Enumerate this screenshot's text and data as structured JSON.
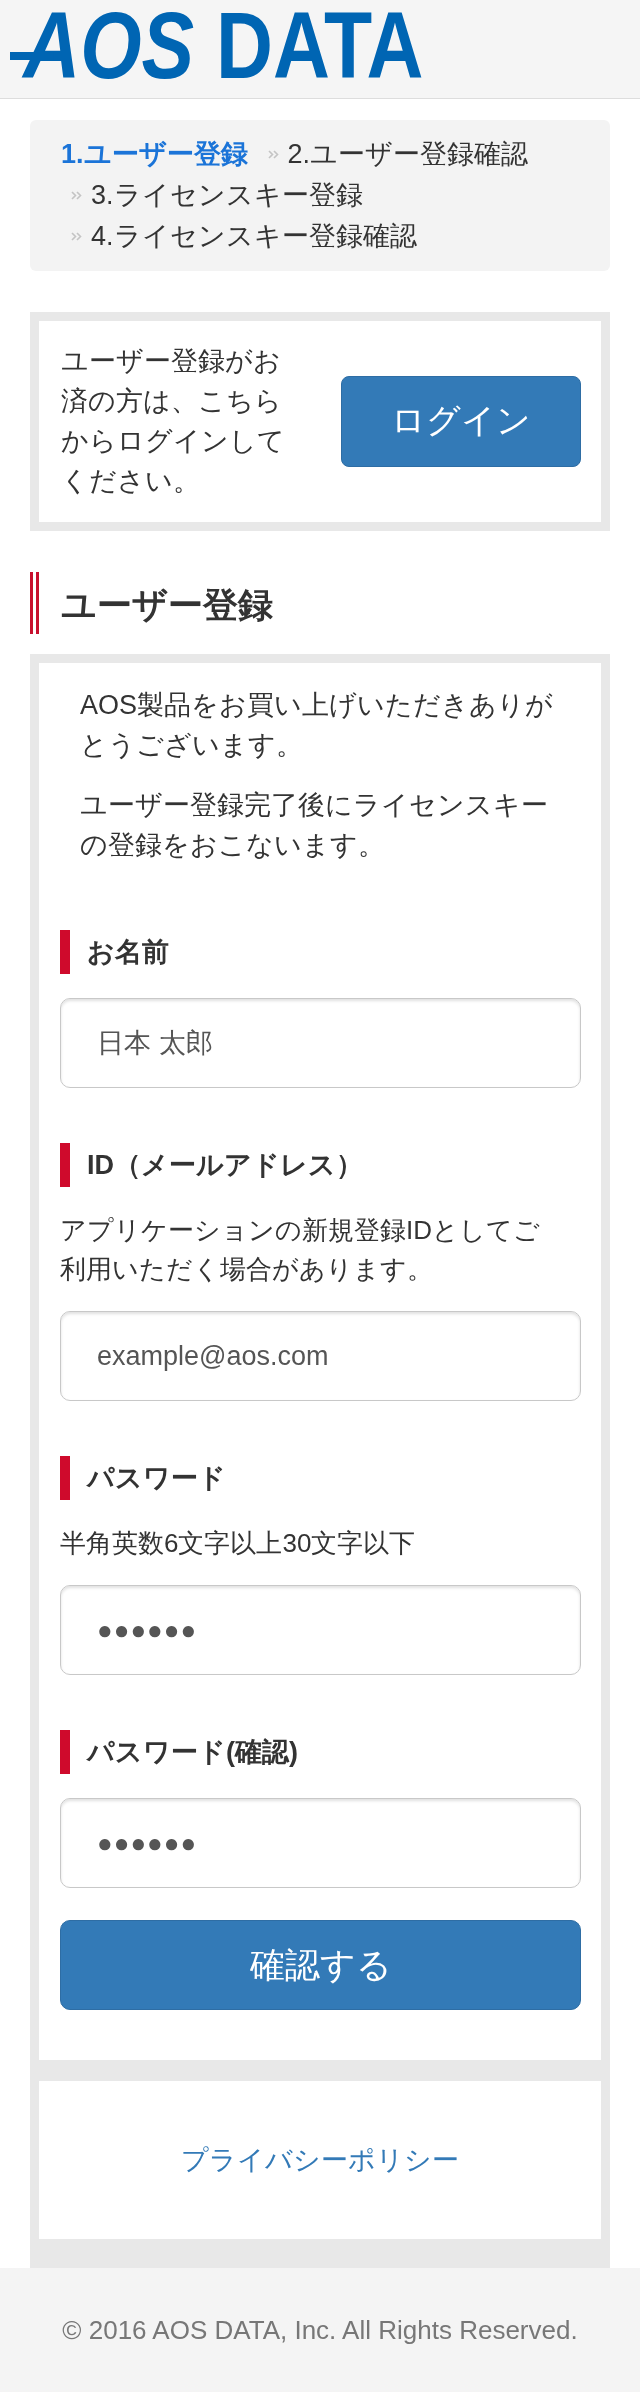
{
  "header": {
    "logo": "*AOS* DATA"
  },
  "steps": [
    {
      "label": "1.ユーザー登録",
      "selected": true
    },
    {
      "label": "2.ユーザー登録確認",
      "selected": false
    },
    {
      "label": "3.ライセンスキー登録",
      "selected": false
    },
    {
      "label": "4.ライセンスキー登録確認",
      "selected": false
    }
  ],
  "login_box": {
    "message": "ユーザー登録がお済の方は、こちらからログインしてください。",
    "button": "ログイン"
  },
  "section_title": "ユーザー登録",
  "form": {
    "intro": [
      "AOS製品をお買い上げいただきありがとうございます。",
      "ユーザー登録完了後にライセンスキーの登録をおこないます。"
    ],
    "fields": [
      {
        "kind": "text",
        "label": "お名前",
        "placeholder": "日本 太郎"
      },
      {
        "kind": "email",
        "label": "ID（メールアドレス）",
        "help": "アプリケーションの新規登録IDとしてご利用いただく場合があります。",
        "placeholder": "example@aos.com"
      },
      {
        "kind": "password",
        "label": "パスワード",
        "help": "半角英数6文字以上30文字以下",
        "placeholder": "●●●●●●"
      },
      {
        "kind": "password",
        "label": "パスワード(確認)",
        "placeholder": "●●●●●●"
      }
    ],
    "submit": "確認する"
  },
  "privacy_link": "プライバシーポリシー",
  "footer": "© 2016 AOS DATA, Inc. All Rights Reserved."
}
